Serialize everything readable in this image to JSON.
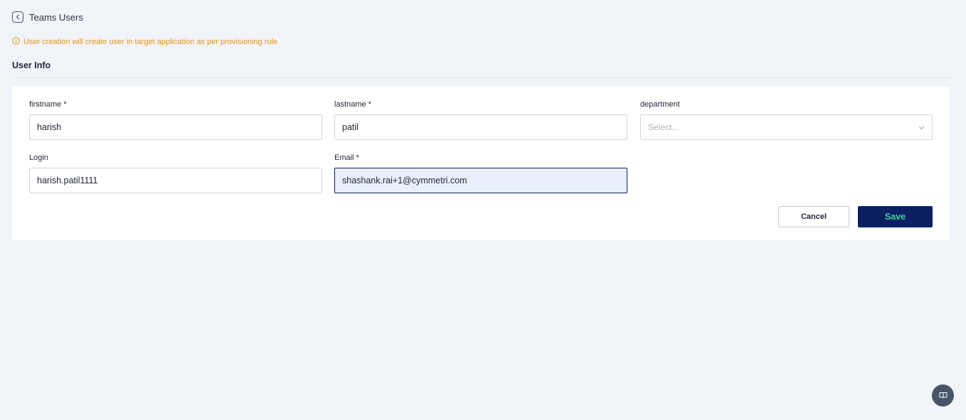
{
  "header": {
    "title": "Teams Users",
    "back_icon": "chevron-left-icon"
  },
  "notice": {
    "text": "User creation will create user in target application as per provisioning rule",
    "icon": "info-icon",
    "color": "#e8930f"
  },
  "section": {
    "title": "User Info"
  },
  "form": {
    "firstname": {
      "label": "firstname *",
      "value": "harish"
    },
    "lastname": {
      "label": "lastname *",
      "value": "patil"
    },
    "department": {
      "label": "department",
      "placeholder": "Select..."
    },
    "login": {
      "label": "Login",
      "value": "harish.patil1111"
    },
    "email": {
      "label": "Email *",
      "value": "shashank.rai+1@cymmetri.com"
    }
  },
  "actions": {
    "cancel_label": "Cancel",
    "save_label": "Save"
  },
  "colors": {
    "primary": "#0b1f62",
    "save_text": "#3ed39b",
    "page_bg": "#f1f4f9",
    "warning": "#e8930f"
  },
  "fab": {
    "icon": "book-icon"
  }
}
